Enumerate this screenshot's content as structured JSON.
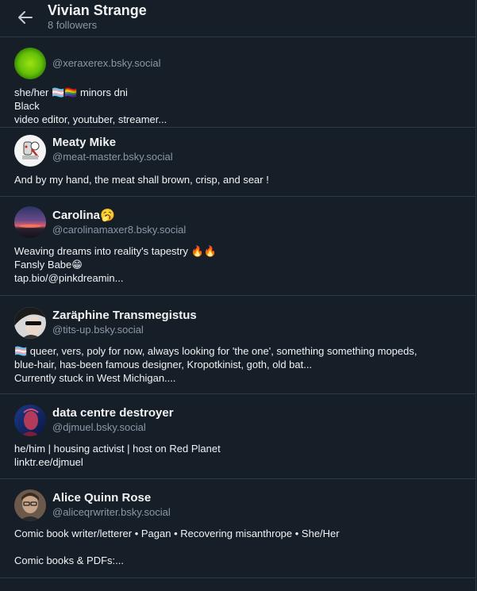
{
  "header": {
    "title": "Vivian Strange",
    "subtitle": "8 followers"
  },
  "followers": [
    {
      "name": "",
      "handle": "@xeraxerex.bsky.social",
      "bio": [
        "she/her 🏳️‍⚧️🏳️‍🌈 minors dni",
        "Black",
        "video editor, youtuber, streamer..."
      ]
    },
    {
      "name": "Meaty Mike",
      "handle": "@meat-master.bsky.social",
      "bio": [
        "And by my hand, the meat shall brown, crisp, and sear !"
      ]
    },
    {
      "name": "Carolina🥱",
      "handle": "@carolinamaxer8.bsky.social",
      "bio": [
        "Weaving dreams into reality's tapestry 🔥🔥",
        "Fansly Babe😁",
        "tap.bio/@pinkdreamin..."
      ]
    },
    {
      "name": "Zaräphine Transmegistus",
      "handle": "@tits-up.bsky.social",
      "bio": [
        "🏳️‍⚧️ queer, vers, poly for now, always looking for 'the one', something something mopeds,",
        "blue-hair, has-been famous designer, Kropotkinist, goth, old bat...",
        "Currently stuck in West Michigan...."
      ]
    },
    {
      "name": "data centre destroyer",
      "handle": "@djmuel.bsky.social",
      "bio": [
        "he/him | housing activist | host on Red Planet",
        "linktr.ee/djmuel"
      ]
    },
    {
      "name": "Alice Quinn Rose",
      "handle": "@aliceqrwriter.bsky.social",
      "bio": [
        "Comic book writer/letterer • Pagan • Recovering misanthrope • She/Her",
        "",
        "Comic books & PDFs:..."
      ]
    }
  ]
}
